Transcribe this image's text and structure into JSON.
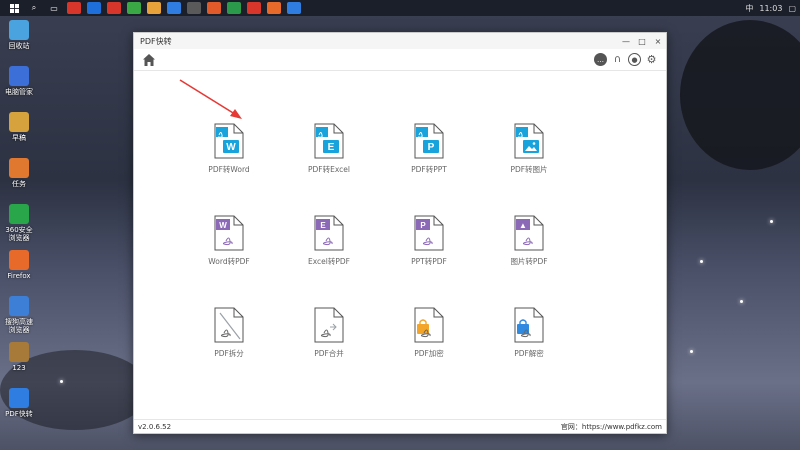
{
  "taskbar": {
    "clock": "11:03",
    "ime": "中"
  },
  "desktop": {
    "items": [
      {
        "label": "回收站",
        "color": "#4aa3df"
      },
      {
        "label": "电脑管家",
        "color": "#3c6fd8"
      },
      {
        "label": "早稿",
        "color": "#d6a23e"
      },
      {
        "label": "任务",
        "color": "#e0782f"
      },
      {
        "label": "360安全浏览器",
        "color": "#2aa64a"
      },
      {
        "label": "Firefox",
        "color": "#e86a2a"
      },
      {
        "label": "搜狗高速浏览器",
        "color": "#3d7fd6"
      },
      {
        "label": "123",
        "color": "#a77a3a"
      },
      {
        "label": "PDF快转",
        "color": "#2f7de1"
      }
    ]
  },
  "window": {
    "title": "PDF快转",
    "controls": [
      "—",
      "□",
      "×"
    ],
    "version": "v2.0.6.52",
    "site": "官网：https://www.pdfkz.com"
  },
  "colors": {
    "blue": "#19a3dc",
    "purple": "#8b69b7",
    "gray": "#9aa0a6",
    "orange": "#f3a52a"
  },
  "tools": [
    {
      "label": "PDF转Word",
      "badge": "W",
      "kind": "to",
      "color": "#19a3dc"
    },
    {
      "label": "PDF转Excel",
      "badge": "E",
      "kind": "to",
      "color": "#19a3dc"
    },
    {
      "label": "PDF转PPT",
      "badge": "P",
      "kind": "to",
      "color": "#19a3dc"
    },
    {
      "label": "PDF转图片",
      "badge": "img",
      "kind": "to",
      "color": "#19a3dc"
    },
    {
      "label": "Word转PDF",
      "badge": "W",
      "kind": "from",
      "color": "#8b69b7"
    },
    {
      "label": "Excel转PDF",
      "badge": "E",
      "kind": "from",
      "color": "#8b69b7"
    },
    {
      "label": "PPT转PDF",
      "badge": "P",
      "kind": "from",
      "color": "#8b69b7"
    },
    {
      "label": "图片转PDF",
      "badge": "img",
      "kind": "from",
      "color": "#8b69b7"
    },
    {
      "label": "PDF拆分",
      "badge": "split",
      "kind": "gray",
      "color": "#9aa0a6"
    },
    {
      "label": "PDF合并",
      "badge": "merge",
      "kind": "gray",
      "color": "#9aa0a6"
    },
    {
      "label": "PDF加密",
      "badge": "lock",
      "kind": "orange",
      "color": "#f3a52a"
    },
    {
      "label": "PDF解密",
      "badge": "unlock",
      "kind": "blue",
      "color": "#2f8ae0"
    }
  ]
}
